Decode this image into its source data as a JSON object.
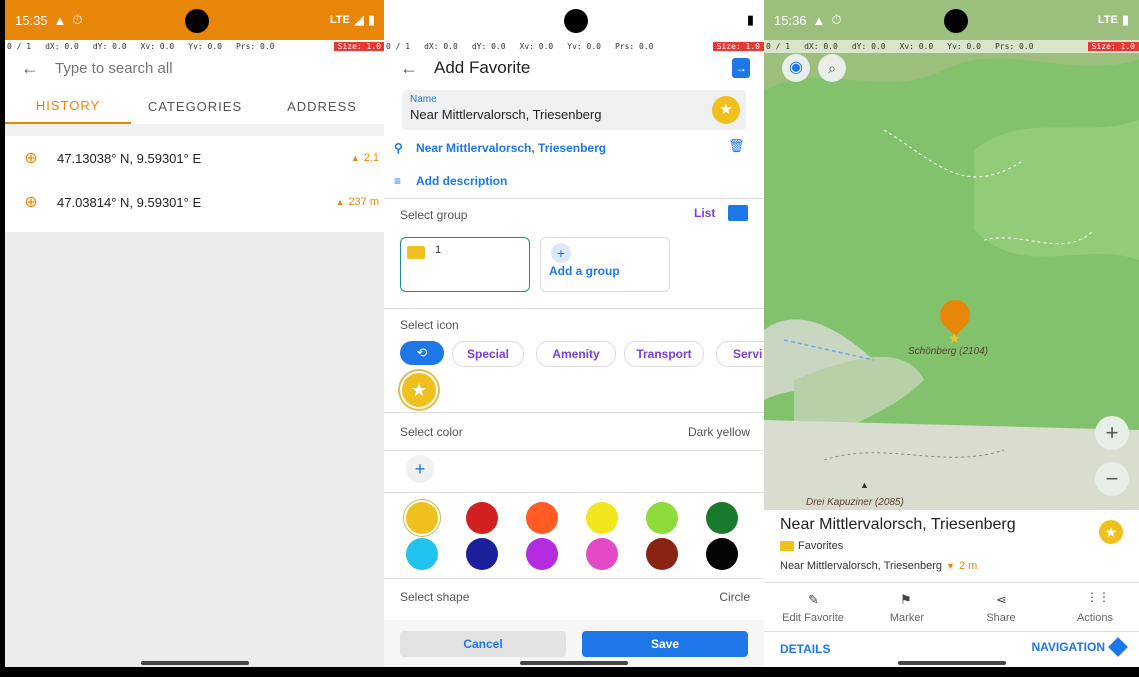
{
  "status": {
    "s1_time": "15:35",
    "s3_time": "15:36",
    "network": "LTE"
  },
  "devbar": {
    "p": "0 / 1",
    "dx": "dX: 0.0",
    "dy": "dY: 0.0",
    "xv": "Xv: 0.0",
    "yv": "Yv: 0.0",
    "prs": "Prs: 0.0",
    "size": "Size: 1.0"
  },
  "search": {
    "placeholder": "Type to search all"
  },
  "tabs": {
    "history": "HISTORY",
    "categories": "CATEGORIES",
    "address": "ADDRESS"
  },
  "history": [
    {
      "coords": "47.13038° N, 9.59301° E",
      "dist": "2.1"
    },
    {
      "coords": "47.03814° N, 9.59301° E",
      "dist": "237 m"
    }
  ],
  "fav": {
    "title": "Add Favorite",
    "name_label": "Name",
    "name_value": "Near Mittlervalorsch, Triesenberg",
    "address": "Near Mittlervalorsch, Triesenberg",
    "add_description": "Add description",
    "select_group": "Select group",
    "list_btn": "List",
    "group_count": "1",
    "add_group": "Add a group",
    "select_icon": "Select icon",
    "icon_cats": [
      "Special",
      "Amenity",
      "Transport",
      "Servi"
    ],
    "select_color": "Select color",
    "color_value": "Dark yellow",
    "colors": [
      "#f0c11e",
      "#d21f1f",
      "#ff5b22",
      "#f1e61b",
      "#8edb3c",
      "#1a7a2b",
      "#20c2ee",
      "#1a1f9b",
      "#b52ce0",
      "#e44ac5",
      "#8b2315",
      "#050505"
    ],
    "select_shape": "Select shape",
    "shape_value": "Circle",
    "cancel": "Cancel",
    "save": "Save"
  },
  "map": {
    "peak_label": "Schönberg (2104)",
    "peak2_label": "Drei Kapuziner (2085)",
    "card_title": "Near Mittlervalorsch, Triesenberg",
    "category": "Favorites",
    "address": "Near Mittlervalorsch, Triesenberg",
    "dist": "2 m",
    "actions": [
      "Edit Favorite",
      "Marker",
      "Share",
      "Actions"
    ],
    "details": "DETAILS",
    "navigation": "NAVIGATION"
  },
  "accent_orange": "#e8860a",
  "accent_blue": "#1e77e8"
}
